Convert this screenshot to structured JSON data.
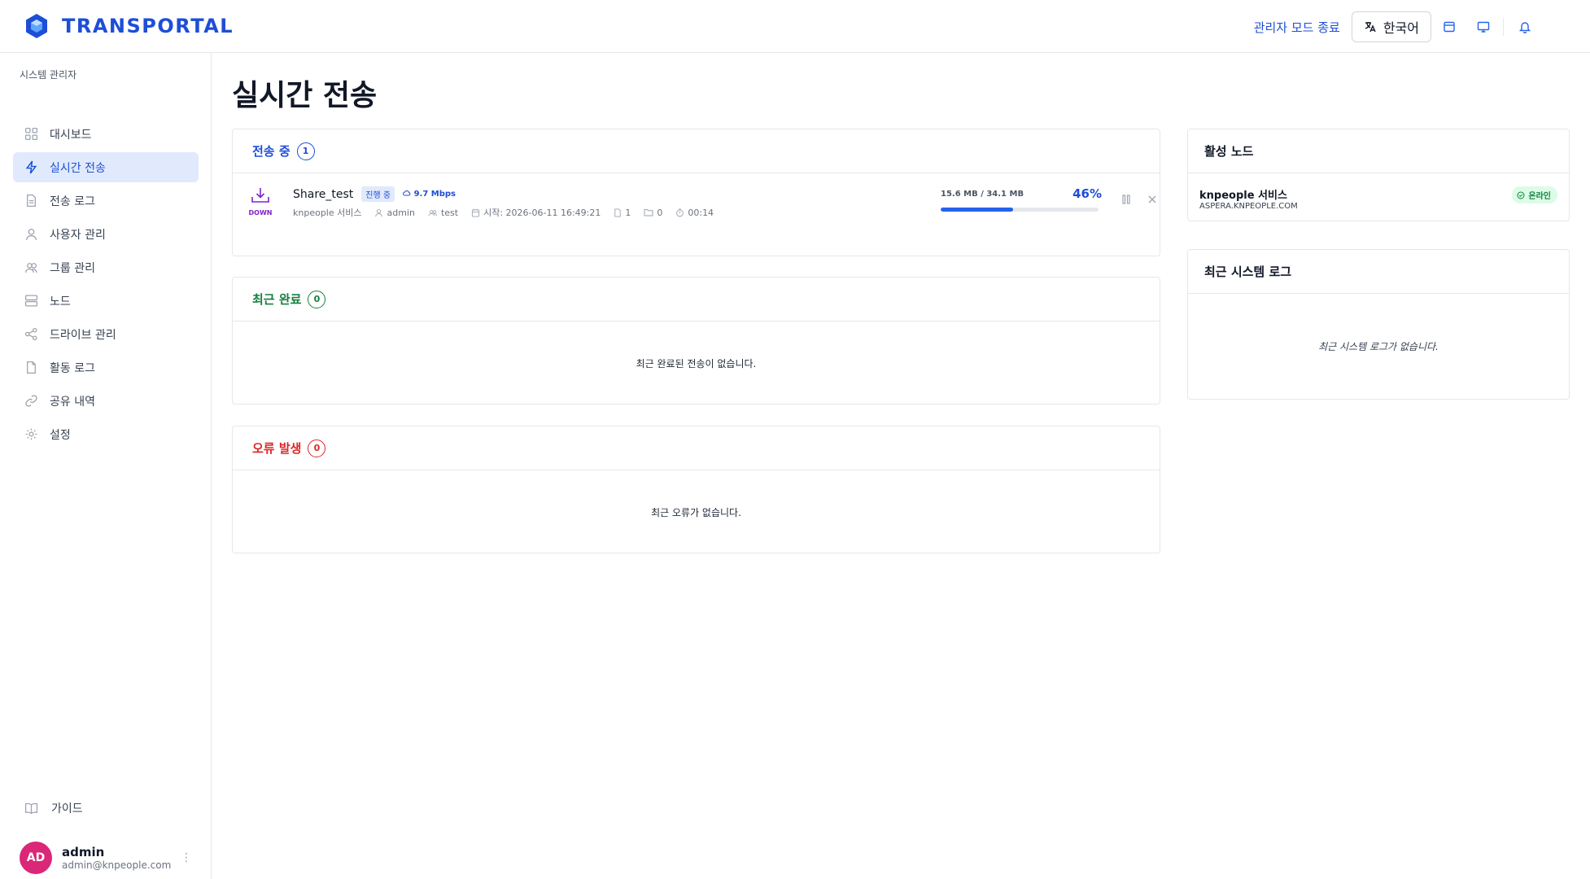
{
  "header": {
    "brand": "TRANSPORTAL",
    "admin_exit": "관리자 모드 종료",
    "language": "한국어"
  },
  "sidebar": {
    "section_label": "시스템 관리자",
    "items": [
      {
        "label": "대시보드",
        "icon": "grid-icon"
      },
      {
        "label": "실시간 전송",
        "icon": "bolt-icon",
        "active": true
      },
      {
        "label": "전송 로그",
        "icon": "document-icon"
      },
      {
        "label": "사용자 관리",
        "icon": "user-icon"
      },
      {
        "label": "그룹 관리",
        "icon": "users-icon"
      },
      {
        "label": "노드",
        "icon": "server-icon"
      },
      {
        "label": "드라이브 관리",
        "icon": "share-nodes-icon"
      },
      {
        "label": "활동 로그",
        "icon": "file-icon"
      },
      {
        "label": "공유 내역",
        "icon": "link-icon"
      },
      {
        "label": "설정",
        "icon": "gear-icon"
      }
    ],
    "guide": "가이드",
    "user": {
      "initials": "AD",
      "name": "admin",
      "email": "admin@knpeople.com"
    }
  },
  "main": {
    "title": "실시간 전송",
    "in_progress": {
      "title": "전송 중",
      "count": "1",
      "transfer": {
        "direction": "DOWN",
        "name": "Share_test",
        "status": "진행 중",
        "speed": "9.7 Mbps",
        "service": "knpeople 서비스",
        "user": "admin",
        "group": "test",
        "started": "시작: 2026-06-11 16:49:21",
        "files": "1",
        "folders": "0",
        "elapsed": "00:14",
        "size_text": "15.6 MB / 34.1 MB",
        "percent_text": "46%",
        "progress": 0.46
      }
    },
    "completed": {
      "title": "최근 완료",
      "count": "0",
      "empty": "최근 완료된 전송이 없습니다."
    },
    "errors": {
      "title": "오류 발생",
      "count": "0",
      "empty": "최근 오류가 없습니다."
    }
  },
  "right": {
    "nodes": {
      "title": "활성 노드",
      "node": {
        "name": "knpeople 서비스",
        "host": "ASPERA.KNPEOPLE.COM",
        "status": "온라인"
      }
    },
    "syslog": {
      "title": "최근 시스템 로그",
      "empty": "최근 시스템 로그가 없습니다."
    }
  },
  "colors": {
    "accent": "#1d4ed8",
    "success": "#15803d",
    "error": "#dc2626",
    "download": "#7e22ce",
    "avatar": "#db2777"
  }
}
